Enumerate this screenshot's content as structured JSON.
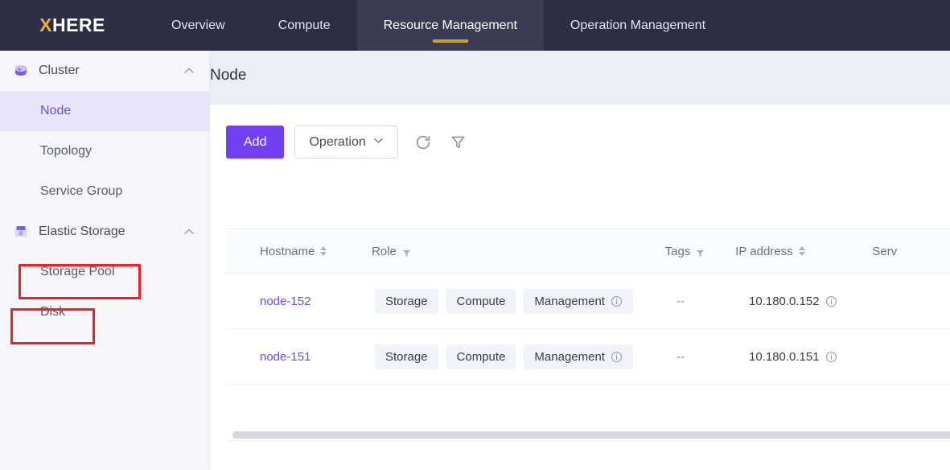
{
  "brand": {
    "x": "X",
    "rest": "HERE"
  },
  "nav": {
    "tabs": [
      {
        "label": "Overview",
        "active": false
      },
      {
        "label": "Compute",
        "active": false
      },
      {
        "label": "Resource Management",
        "active": true
      },
      {
        "label": "Operation Management",
        "active": false
      }
    ]
  },
  "sidebar": {
    "groups": [
      {
        "label": "Cluster",
        "icon": "cluster-icon",
        "expanded": true,
        "items": [
          {
            "label": "Node",
            "active": true
          },
          {
            "label": "Topology",
            "active": false
          },
          {
            "label": "Service Group",
            "active": false
          }
        ]
      },
      {
        "label": "Elastic Storage",
        "icon": "storage-icon",
        "expanded": true,
        "items": [
          {
            "label": "Storage Pool",
            "active": false,
            "highlighted": true
          },
          {
            "label": "Disk",
            "active": false,
            "highlighted": true
          }
        ]
      }
    ]
  },
  "page": {
    "title": "Node"
  },
  "toolbar": {
    "add_label": "Add",
    "operation_label": "Operation",
    "refresh_icon": "refresh-icon",
    "filter_icon": "filter-icon"
  },
  "table": {
    "columns": [
      {
        "label": "Hostname",
        "sortable": true,
        "filterable": false
      },
      {
        "label": "Role",
        "sortable": false,
        "filterable": true
      },
      {
        "label": "Tags",
        "sortable": false,
        "filterable": true
      },
      {
        "label": "IP address",
        "sortable": true,
        "filterable": false
      },
      {
        "label": "Serv",
        "sortable": false,
        "filterable": false
      }
    ],
    "rows": [
      {
        "hostname": "node-152",
        "roles": [
          {
            "label": "Storage",
            "info": false
          },
          {
            "label": "Compute",
            "info": false
          },
          {
            "label": "Management",
            "info": true
          }
        ],
        "tags": "--",
        "ip": "10.180.0.152",
        "ip_info": true
      },
      {
        "hostname": "node-151",
        "roles": [
          {
            "label": "Storage",
            "info": false
          },
          {
            "label": "Compute",
            "info": false
          },
          {
            "label": "Management",
            "info": true
          }
        ],
        "tags": "--",
        "ip": "10.180.0.151",
        "ip_info": true
      }
    ]
  },
  "colors": {
    "nav_bg": "#2d2e44",
    "nav_active_bg": "#3b3c54",
    "nav_underline": "#c9a22b",
    "brand_accent": "#e8b13a",
    "primary": "#7240f1",
    "link": "#6b4ee0",
    "sidebar_bg": "#f5f5fa",
    "sidebar_active_bg": "#e8e5fb",
    "annotation": "#f41e1e"
  }
}
